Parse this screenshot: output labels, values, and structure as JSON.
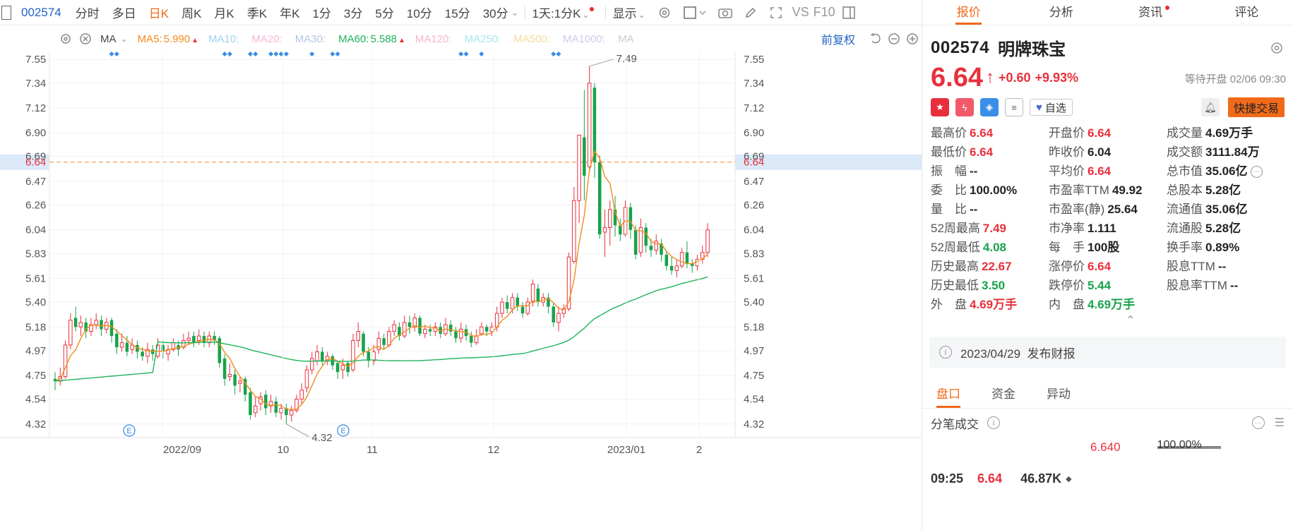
{
  "toolbar": {
    "code": "002574",
    "periods": [
      "分时",
      "多日",
      "日K",
      "周K",
      "月K",
      "季K",
      "年K",
      "1分",
      "3分",
      "5分",
      "10分",
      "15分",
      "30分"
    ],
    "active_period": "日K",
    "combo": "1天:1分K",
    "display": "显示",
    "vs_label": "VS",
    "f10_label": "F10"
  },
  "ma_bar": {
    "type": "MA",
    "items": [
      {
        "label": "MA5:",
        "value": "5.990",
        "color": "#f28c1a",
        "arrow": "▲"
      },
      {
        "label": "MA10:",
        "value": "",
        "color": "#9fd3f0",
        "arrow": ""
      },
      {
        "label": "MA20:",
        "value": "",
        "color": "#f4b8d8",
        "arrow": ""
      },
      {
        "label": "MA30:",
        "value": "",
        "color": "#b6c6e6",
        "arrow": ""
      },
      {
        "label": "MA60:",
        "value": "5.588",
        "color": "#21b35b",
        "arrow": "▲"
      },
      {
        "label": "MA120:",
        "value": "",
        "color": "#f4b8c8",
        "arrow": ""
      },
      {
        "label": "MA250:",
        "value": "",
        "color": "#a8e6f0",
        "arrow": ""
      },
      {
        "label": "MA500:",
        "value": "",
        "color": "#f6dca0",
        "arrow": ""
      },
      {
        "label": "MA1000:",
        "value": "",
        "color": "#d3c8f0",
        "arrow": ""
      },
      {
        "label": "MA",
        "value": "",
        "color": "#cccccc",
        "arrow": ""
      }
    ],
    "adjust": "前复权"
  },
  "chart_data": {
    "type": "candlestick",
    "y_ticks": [
      "7.55",
      "7.34",
      "7.12",
      "6.90",
      "6.69",
      "6.64",
      "6.47",
      "6.26",
      "6.04",
      "5.83",
      "5.61",
      "5.40",
      "5.18",
      "4.97",
      "4.75",
      "4.54",
      "4.32"
    ],
    "ylim": [
      4.2,
      7.62
    ],
    "current_price_line": "6.64",
    "x_labels": [
      "2022/09",
      "10",
      "11",
      "12",
      "2023/01",
      "2"
    ],
    "annotations": {
      "high": "7.49",
      "low": "4.32"
    },
    "ma5_color": "#f28c1a",
    "ma60_color": "#21b35b",
    "up_color": "#e8303c",
    "down_color": "#16a34a",
    "candles": [
      [
        4.72,
        4.7,
        4.78,
        4.62
      ],
      [
        4.7,
        4.74,
        4.82,
        4.66
      ],
      [
        4.74,
        5.02,
        5.06,
        4.72
      ],
      [
        5.02,
        5.24,
        5.3,
        4.98
      ],
      [
        5.26,
        5.18,
        5.36,
        5.14
      ],
      [
        5.18,
        5.22,
        5.28,
        5.1
      ],
      [
        5.22,
        5.14,
        5.26,
        5.08
      ],
      [
        5.14,
        5.2,
        5.26,
        5.1
      ],
      [
        5.2,
        5.24,
        5.3,
        5.16
      ],
      [
        5.24,
        5.16,
        5.28,
        5.1
      ],
      [
        5.16,
        5.22,
        5.26,
        5.12
      ],
      [
        5.24,
        5.1,
        5.26,
        5.04
      ],
      [
        5.12,
        5.0,
        5.16,
        4.94
      ],
      [
        5.0,
        5.04,
        5.12,
        4.96
      ],
      [
        5.04,
        4.96,
        5.1,
        4.92
      ],
      [
        4.98,
        5.02,
        5.08,
        4.94
      ],
      [
        5.02,
        4.96,
        5.06,
        4.9
      ],
      [
        4.96,
        4.92,
        5.0,
        4.88
      ],
      [
        4.92,
        4.98,
        5.04,
        4.86
      ],
      [
        4.98,
        4.94,
        5.02,
        4.88
      ],
      [
        4.92,
        5.02,
        5.08,
        4.9
      ],
      [
        5.02,
        4.96,
        5.06,
        4.9
      ],
      [
        4.94,
        4.98,
        5.02,
        4.88
      ],
      [
        4.98,
        5.04,
        5.08,
        4.96
      ],
      [
        5.02,
        4.98,
        5.06,
        4.92
      ],
      [
        5.0,
        5.06,
        5.12,
        4.98
      ],
      [
        5.06,
        5.08,
        5.14,
        5.02
      ],
      [
        5.1,
        5.04,
        5.14,
        5.0
      ],
      [
        5.06,
        5.1,
        5.16,
        5.02
      ],
      [
        5.1,
        5.04,
        5.14,
        5.0
      ],
      [
        5.04,
        5.1,
        5.14,
        5.0
      ],
      [
        5.1,
        5.06,
        5.14,
        5.02
      ],
      [
        5.08,
        4.86,
        5.1,
        4.82
      ],
      [
        4.9,
        4.72,
        4.94,
        4.66
      ],
      [
        4.74,
        4.76,
        4.86,
        4.7
      ],
      [
        4.76,
        4.66,
        4.8,
        4.58
      ],
      [
        4.68,
        4.7,
        4.74,
        4.6
      ],
      [
        4.72,
        4.58,
        4.74,
        4.52
      ],
      [
        4.6,
        4.4,
        4.64,
        4.36
      ],
      [
        4.42,
        4.48,
        4.56,
        4.38
      ],
      [
        4.5,
        4.56,
        4.6,
        4.44
      ],
      [
        4.58,
        4.46,
        4.62,
        4.4
      ],
      [
        4.48,
        4.52,
        4.58,
        4.42
      ],
      [
        4.52,
        4.42,
        4.56,
        4.38
      ],
      [
        4.42,
        4.46,
        4.5,
        4.36
      ],
      [
        4.46,
        4.4,
        4.5,
        4.32
      ],
      [
        4.4,
        4.44,
        4.48,
        4.34
      ],
      [
        4.44,
        4.54,
        4.58,
        4.42
      ],
      [
        4.54,
        4.62,
        4.68,
        4.5
      ],
      [
        4.64,
        4.8,
        4.84,
        4.6
      ],
      [
        4.8,
        4.9,
        4.96,
        4.76
      ],
      [
        4.88,
        4.96,
        5.02,
        4.84
      ],
      [
        4.96,
        4.88,
        5.0,
        4.84
      ],
      [
        4.88,
        4.92,
        4.96,
        4.84
      ],
      [
        4.92,
        4.84,
        4.94,
        4.8
      ],
      [
        4.86,
        4.78,
        4.88,
        4.72
      ],
      [
        4.8,
        4.84,
        4.9,
        4.72
      ],
      [
        4.86,
        4.78,
        4.88,
        4.74
      ],
      [
        4.8,
        5.06,
        5.12,
        4.78
      ],
      [
        5.06,
        5.14,
        5.22,
        5.0
      ],
      [
        5.12,
        4.96,
        5.14,
        4.92
      ],
      [
        4.96,
        4.88,
        5.0,
        4.82
      ],
      [
        4.88,
        4.96,
        5.02,
        4.84
      ],
      [
        4.98,
        5.08,
        5.14,
        4.94
      ],
      [
        5.08,
        5.02,
        5.12,
        4.98
      ],
      [
        5.02,
        5.14,
        5.18,
        5.0
      ],
      [
        5.14,
        5.2,
        5.24,
        5.1
      ],
      [
        5.18,
        5.1,
        5.22,
        5.06
      ],
      [
        5.1,
        5.22,
        5.28,
        5.08
      ],
      [
        5.22,
        5.18,
        5.28,
        5.12
      ],
      [
        5.18,
        5.26,
        5.3,
        5.14
      ],
      [
        5.26,
        5.12,
        5.28,
        5.1
      ],
      [
        5.12,
        5.16,
        5.2,
        5.08
      ],
      [
        5.16,
        5.14,
        5.2,
        5.1
      ],
      [
        5.14,
        5.18,
        5.22,
        5.1
      ],
      [
        5.18,
        5.12,
        5.22,
        5.08
      ],
      [
        5.12,
        5.2,
        5.26,
        5.1
      ],
      [
        5.2,
        5.14,
        5.24,
        5.1
      ],
      [
        5.14,
        5.08,
        5.18,
        5.04
      ],
      [
        5.08,
        5.16,
        5.22,
        5.04
      ],
      [
        5.16,
        5.1,
        5.2,
        5.06
      ],
      [
        5.1,
        5.04,
        5.14,
        5.0
      ],
      [
        5.04,
        5.1,
        5.16,
        5.02
      ],
      [
        5.12,
        5.18,
        5.22,
        5.1
      ],
      [
        5.18,
        5.14,
        5.2,
        5.1
      ],
      [
        5.14,
        5.18,
        5.22,
        5.1
      ],
      [
        5.18,
        5.3,
        5.36,
        5.14
      ],
      [
        5.3,
        5.4,
        5.44,
        5.26
      ],
      [
        5.4,
        5.34,
        5.46,
        5.3
      ],
      [
        5.34,
        5.44,
        5.48,
        5.3
      ],
      [
        5.44,
        5.36,
        5.48,
        5.32
      ],
      [
        5.36,
        5.3,
        5.4,
        5.26
      ],
      [
        5.3,
        5.4,
        5.44,
        5.28
      ],
      [
        5.4,
        5.56,
        5.6,
        5.36
      ],
      [
        5.52,
        5.4,
        5.56,
        5.36
      ],
      [
        5.4,
        5.44,
        5.48,
        5.36
      ],
      [
        5.44,
        5.36,
        5.48,
        5.3
      ],
      [
        5.36,
        5.22,
        5.4,
        5.18
      ],
      [
        5.22,
        5.3,
        5.36,
        5.14
      ],
      [
        5.3,
        5.34,
        5.38,
        5.26
      ],
      [
        5.34,
        5.8,
        5.84,
        5.32
      ],
      [
        5.76,
        6.3,
        6.42,
        5.74
      ],
      [
        6.3,
        6.88,
        6.88,
        6.1
      ],
      [
        6.86,
        6.52,
        7.28,
        6.3
      ],
      [
        6.6,
        7.34,
        7.49,
        6.56
      ],
      [
        7.3,
        6.64,
        7.34,
        6.5
      ],
      [
        6.64,
        6.0,
        6.7,
        5.96
      ],
      [
        6.02,
        6.06,
        6.22,
        5.8
      ],
      [
        6.06,
        6.22,
        6.3,
        5.9
      ],
      [
        6.22,
        6.08,
        6.34,
        5.98
      ],
      [
        6.08,
        6.0,
        6.14,
        5.94
      ],
      [
        6.0,
        6.24,
        6.3,
        5.98
      ],
      [
        6.24,
        6.04,
        6.28,
        5.96
      ],
      [
        6.04,
        5.82,
        6.08,
        5.78
      ],
      [
        5.84,
        6.06,
        6.14,
        5.8
      ],
      [
        6.06,
        5.9,
        6.1,
        5.84
      ],
      [
        5.9,
        5.86,
        5.96,
        5.8
      ],
      [
        5.86,
        5.94,
        6.0,
        5.82
      ],
      [
        5.92,
        5.82,
        5.96,
        5.76
      ],
      [
        5.82,
        5.72,
        5.86,
        5.68
      ],
      [
        5.72,
        5.68,
        5.8,
        5.64
      ],
      [
        5.68,
        5.72,
        5.78,
        5.62
      ],
      [
        5.72,
        5.84,
        5.88,
        5.7
      ],
      [
        5.84,
        5.74,
        5.94,
        5.7
      ],
      [
        5.74,
        5.72,
        5.78,
        5.66
      ],
      [
        5.72,
        5.78,
        5.82,
        5.68
      ],
      [
        5.78,
        5.84,
        5.9,
        5.74
      ],
      [
        5.84,
        6.04,
        6.1,
        5.8
      ]
    ]
  },
  "panel": {
    "tabs": [
      "报价",
      "分析",
      "资讯",
      "评论"
    ],
    "active_tab": "报价",
    "code": "002574",
    "name": "明牌珠宝",
    "price": "6.64",
    "arrow": "↑",
    "change": "+0.60",
    "change_pct": "+9.93%",
    "wait_text": "等待开盘 02/06 09:30",
    "watch_label": "自选",
    "trade_label": "快捷交易",
    "rows": [
      [
        {
          "k": "最高价",
          "v": "6.64",
          "c": "red"
        },
        {
          "k": "开盘价",
          "v": "6.64",
          "c": "red"
        },
        {
          "k": "成交量",
          "v": "4.69万手",
          "c": "dark"
        }
      ],
      [
        {
          "k": "最低价",
          "v": "6.64",
          "c": "red"
        },
        {
          "k": "昨收价",
          "v": "6.04",
          "c": "dark"
        },
        {
          "k": "成交额",
          "v": "3111.84万",
          "c": "dark"
        }
      ],
      [
        {
          "k": "振　幅",
          "v": "--",
          "c": "dark"
        },
        {
          "k": "平均价",
          "v": "6.64",
          "c": "red"
        },
        {
          "k": "总市值",
          "v": "35.06亿",
          "c": "dark"
        }
      ],
      [
        {
          "k": "委　比",
          "v": "100.00%",
          "c": "dark"
        },
        {
          "k": "市盈率TTM",
          "v": "49.92",
          "c": "dark"
        },
        {
          "k": "总股本",
          "v": "5.28亿",
          "c": "dark"
        }
      ],
      [
        {
          "k": "量　比",
          "v": "--",
          "c": "dark"
        },
        {
          "k": "市盈率(静)",
          "v": "25.64",
          "c": "dark"
        },
        {
          "k": "流通值",
          "v": "35.06亿",
          "c": "dark"
        }
      ],
      [
        {
          "k": "52周最高",
          "v": "7.49",
          "c": "red"
        },
        {
          "k": "市净率",
          "v": "1.111",
          "c": "dark"
        },
        {
          "k": "流通股",
          "v": "5.28亿",
          "c": "dark"
        }
      ],
      [
        {
          "k": "52周最低",
          "v": "4.08",
          "c": "green"
        },
        {
          "k": "每　手",
          "v": "100股",
          "c": "dark"
        },
        {
          "k": "换手率",
          "v": "0.89%",
          "c": "dark"
        }
      ],
      [
        {
          "k": "历史最高",
          "v": "22.67",
          "c": "red"
        },
        {
          "k": "涨停价",
          "v": "6.64",
          "c": "red"
        },
        {
          "k": "股息TTM",
          "v": "--",
          "c": "dark"
        }
      ],
      [
        {
          "k": "历史最低",
          "v": "3.50",
          "c": "green"
        },
        {
          "k": "跌停价",
          "v": "5.44",
          "c": "green"
        },
        {
          "k": "股息率TTM",
          "v": "--",
          "c": "dark"
        }
      ],
      [
        {
          "k": "外　盘",
          "v": "4.69万手",
          "c": "red"
        },
        {
          "k": "内　盘",
          "v": "4.69万手",
          "c": "green"
        },
        {
          "k": "",
          "v": "",
          "c": "dark"
        }
      ]
    ],
    "notice": "2023/04/29  发布财报",
    "subtabs": [
      "盘口",
      "资金",
      "异动"
    ],
    "active_subtab": "盘口",
    "tick_title": "分笔成交",
    "tick_price": "6.640",
    "tick_pct": "100.00%",
    "tick_time": "09:25",
    "tick_row_price": "6.64",
    "tick_row_vol": "46.87K",
    "tick_row_mark": "◆"
  }
}
